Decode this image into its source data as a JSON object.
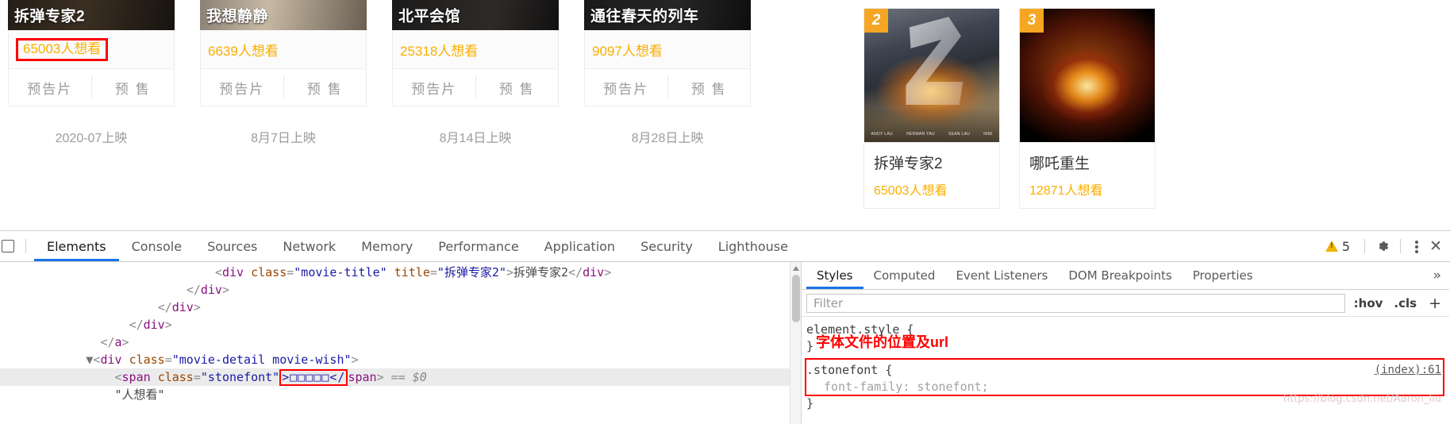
{
  "page": {
    "coming_soon": [
      {
        "title": "拆弹专家2",
        "wish": "65003人想看",
        "trailer_label": "预告片",
        "presale_label": "预 售",
        "release": "2020-07上映",
        "highlighted": true
      },
      {
        "title": "我想静静",
        "wish": "6639人想看",
        "trailer_label": "预告片",
        "presale_label": "预 售",
        "release": "8月7日上映",
        "highlighted": false
      },
      {
        "title": "北平会馆",
        "wish": "25318人想看",
        "trailer_label": "预告片",
        "presale_label": "预 售",
        "release": "8月14日上映",
        "highlighted": false
      },
      {
        "title": "通往春天的列车",
        "wish": "9097人想看",
        "trailer_label": "预告片",
        "presale_label": "预 售",
        "release": "8月28日上映",
        "highlighted": false
      }
    ],
    "ranking": [
      {
        "rank": "2",
        "title": "拆弹专家2",
        "wish": "65003人想看",
        "credits": [
          "ANDY LAU",
          "HERMAN YAU",
          "SEAN LAU",
          "NINI"
        ]
      },
      {
        "rank": "3",
        "title": "哪吒重生",
        "wish": "12871人想看",
        "credits": [
          "",
          "",
          "",
          ""
        ]
      }
    ],
    "colors": {
      "wish_orange": "#faaf00",
      "badge_orange": "#f5a623",
      "annotation_red": "#ff0000"
    }
  },
  "devtools": {
    "tabs": [
      "Elements",
      "Console",
      "Sources",
      "Network",
      "Memory",
      "Performance",
      "Application",
      "Security",
      "Lighthouse"
    ],
    "active_tab": "Elements",
    "warning_count": "5",
    "icons": {
      "inspect": "inspect-element-icon",
      "gear": "settings-gear-icon",
      "kebab": "more-options-icon",
      "close": "close-devtools-icon",
      "warning": "warning-triangle-icon"
    },
    "close_glyph": "✕",
    "more_glyph": "»",
    "dom": {
      "lines": [
        {
          "indent": 9,
          "parts": [
            {
              "t": "punct",
              "v": "<"
            },
            {
              "t": "tag",
              "v": "div"
            },
            {
              "t": "plain",
              "v": " "
            },
            {
              "t": "attr",
              "v": "class"
            },
            {
              "t": "punct",
              "v": "="
            },
            {
              "t": "val",
              "v": "\"movie-title\""
            },
            {
              "t": "plain",
              "v": " "
            },
            {
              "t": "attr",
              "v": "title"
            },
            {
              "t": "punct",
              "v": "="
            },
            {
              "t": "val",
              "v": "\"拆弹专家2\""
            },
            {
              "t": "punct",
              "v": ">"
            },
            {
              "t": "text",
              "v": "拆弹专家2"
            },
            {
              "t": "punct",
              "v": "</"
            },
            {
              "t": "tag",
              "v": "div"
            },
            {
              "t": "punct",
              "v": ">"
            }
          ]
        },
        {
          "indent": 7,
          "parts": [
            {
              "t": "punct",
              "v": "</"
            },
            {
              "t": "tag",
              "v": "div"
            },
            {
              "t": "punct",
              "v": ">"
            }
          ]
        },
        {
          "indent": 5,
          "parts": [
            {
              "t": "punct",
              "v": "</"
            },
            {
              "t": "tag",
              "v": "div"
            },
            {
              "t": "punct",
              "v": ">"
            }
          ]
        },
        {
          "indent": 3,
          "parts": [
            {
              "t": "punct",
              "v": "</"
            },
            {
              "t": "tag",
              "v": "div"
            },
            {
              "t": "punct",
              "v": ">"
            }
          ]
        },
        {
          "indent": 1,
          "parts": [
            {
              "t": "punct",
              "v": "</"
            },
            {
              "t": "tag",
              "v": "a"
            },
            {
              "t": "punct",
              "v": ">"
            }
          ]
        },
        {
          "indent": 0,
          "arrow": true,
          "parts": [
            {
              "t": "punct",
              "v": "<"
            },
            {
              "t": "tag",
              "v": "div"
            },
            {
              "t": "plain",
              "v": " "
            },
            {
              "t": "attr",
              "v": "class"
            },
            {
              "t": "punct",
              "v": "="
            },
            {
              "t": "val",
              "v": "\"movie-detail movie-wish\""
            },
            {
              "t": "punct",
              "v": ">"
            }
          ]
        },
        {
          "indent": 2,
          "selected": true,
          "parts": [
            {
              "t": "punct",
              "v": "<"
            },
            {
              "t": "tag",
              "v": "span"
            },
            {
              "t": "plain",
              "v": " "
            },
            {
              "t": "attr",
              "v": "class"
            },
            {
              "t": "punct",
              "v": "="
            },
            {
              "t": "val",
              "v": "\"stonefont\""
            },
            {
              "t": "redbox",
              "v": ">□□□□□</"
            },
            {
              "t": "tag",
              "v": "span"
            },
            {
              "t": "punct",
              "v": ">"
            },
            {
              "t": "plain",
              "v": " "
            },
            {
              "t": "ref",
              "v": "== $0"
            }
          ]
        },
        {
          "indent": 2,
          "parts": [
            {
              "t": "text",
              "v": "\"人想看\""
            }
          ]
        }
      ]
    },
    "styles": {
      "tabs": [
        "Styles",
        "Computed",
        "Event Listeners",
        "DOM Breakpoints",
        "Properties"
      ],
      "active_tab": "Styles",
      "filter_placeholder": "Filter",
      "hov": ":hov",
      "cls": ".cls",
      "plus": "+",
      "element_style": "element.style {",
      "element_style_close": "}",
      "annotation": "字体文件的位置及url",
      "rule_selector": ".stonefont {",
      "rule_source": "(index):61",
      "rule_property": "font-family",
      "rule_value": "stonefont;",
      "rule_close": "}",
      "watermark": "https://blog.csdn.net/Aaron_liu"
    }
  }
}
